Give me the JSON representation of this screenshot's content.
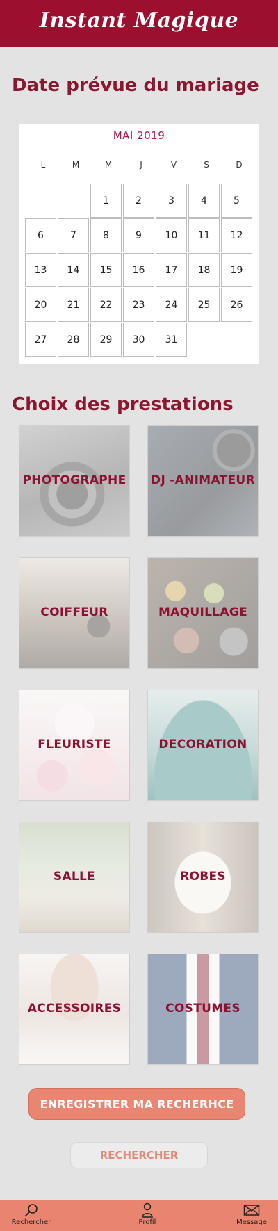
{
  "app": {
    "title": "Instant Magique"
  },
  "date_section": {
    "title": "Date prévue du mariage"
  },
  "calendar": {
    "month_label": "MAI 2019",
    "weekdays": [
      "L",
      "M",
      "M",
      "J",
      "V",
      "S",
      "D"
    ],
    "days": [
      "1",
      "2",
      "3",
      "4",
      "5",
      "6",
      "7",
      "8",
      "9",
      "10",
      "11",
      "12",
      "13",
      "14",
      "15",
      "16",
      "17",
      "18",
      "19",
      "20",
      "21",
      "22",
      "23",
      "24",
      "25",
      "26",
      "27",
      "28",
      "29",
      "30",
      "31"
    ]
  },
  "services_section": {
    "title": "Choix des prestations",
    "items": [
      {
        "label": "PHOTOGRAPHE"
      },
      {
        "label": "DJ -ANIMATEUR"
      },
      {
        "label": "COIFFEUR"
      },
      {
        "label": "MAQUILLAGE"
      },
      {
        "label": "FLEURISTE"
      },
      {
        "label": "DECORATION"
      },
      {
        "label": "SALLE"
      },
      {
        "label": "ROBES"
      },
      {
        "label": "ACCESSOIRES"
      },
      {
        "label": "COSTUMES"
      }
    ]
  },
  "actions": {
    "save_label": "ENREGISTRER MA RECHERHCE",
    "search_label": "RECHERCHER"
  },
  "navbar": {
    "items": [
      {
        "label": "Rechercher",
        "icon": "search-icon"
      },
      {
        "label": "Profil",
        "icon": "user-icon"
      },
      {
        "label": "Message",
        "icon": "envelope-icon"
      }
    ]
  },
  "colors": {
    "brand": "#9c0f2e",
    "accent": "#e8846f",
    "calendar_month": "#b01253"
  }
}
